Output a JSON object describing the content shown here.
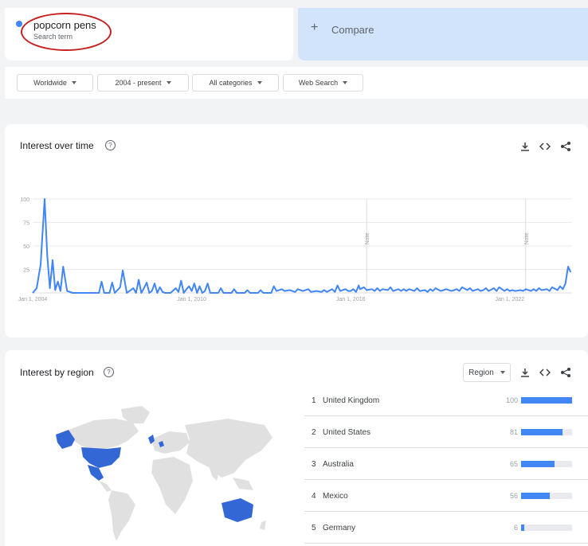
{
  "search": {
    "term": "popcorn pens",
    "subtitle": "Search term",
    "compare_label": "Compare",
    "compare_icon": "plus-icon"
  },
  "filters": [
    {
      "label": "Worldwide"
    },
    {
      "label": "2004 - present"
    },
    {
      "label": "All categories"
    },
    {
      "label": "Web Search"
    }
  ],
  "interest_over_time": {
    "title": "Interest over time",
    "help": "?",
    "tools": [
      "download-icon",
      "embed-icon",
      "share-icon"
    ]
  },
  "chart_data": {
    "type": "line",
    "ylim": [
      0,
      100
    ],
    "yticks": [
      "100",
      "75",
      "50",
      "25"
    ],
    "xticks": [
      "Jan 1, 2004",
      "Jan 1, 2010",
      "Jan 1, 2016",
      "Jan 1, 2022"
    ],
    "notes": [
      {
        "label": "Note",
        "year": 2016.6
      },
      {
        "label": "Note",
        "year": 2022.6
      }
    ],
    "series": [
      {
        "color": "#4285f4",
        "points": [
          [
            2004.0,
            0
          ],
          [
            2004.15,
            5
          ],
          [
            2004.3,
            30
          ],
          [
            2004.45,
            100
          ],
          [
            2004.55,
            40
          ],
          [
            2004.65,
            5
          ],
          [
            2004.75,
            35
          ],
          [
            2004.85,
            3
          ],
          [
            2004.95,
            12
          ],
          [
            2005.05,
            2
          ],
          [
            2005.15,
            28
          ],
          [
            2005.3,
            2
          ],
          [
            2005.5,
            0
          ],
          [
            2006.5,
            0
          ],
          [
            2006.6,
            12
          ],
          [
            2006.7,
            0
          ],
          [
            2006.9,
            0
          ],
          [
            2007.0,
            11
          ],
          [
            2007.1,
            0
          ],
          [
            2007.3,
            6
          ],
          [
            2007.4,
            24
          ],
          [
            2007.55,
            0
          ],
          [
            2007.8,
            5
          ],
          [
            2007.9,
            0
          ],
          [
            2008.0,
            14
          ],
          [
            2008.1,
            0
          ],
          [
            2008.2,
            5
          ],
          [
            2008.3,
            11
          ],
          [
            2008.4,
            0
          ],
          [
            2008.5,
            2
          ],
          [
            2008.6,
            10
          ],
          [
            2008.7,
            0
          ],
          [
            2008.8,
            6
          ],
          [
            2008.9,
            1
          ],
          [
            2009.0,
            0
          ],
          [
            2009.2,
            0
          ],
          [
            2009.4,
            5
          ],
          [
            2009.5,
            1
          ],
          [
            2009.6,
            13
          ],
          [
            2009.7,
            0
          ],
          [
            2009.8,
            4
          ],
          [
            2009.9,
            7
          ],
          [
            2010.0,
            2
          ],
          [
            2010.1,
            10
          ],
          [
            2010.2,
            0
          ],
          [
            2010.3,
            7
          ],
          [
            2010.4,
            0
          ],
          [
            2010.5,
            2
          ],
          [
            2010.6,
            10
          ],
          [
            2010.7,
            0
          ],
          [
            2011.0,
            0
          ],
          [
            2011.1,
            5
          ],
          [
            2011.2,
            0
          ],
          [
            2011.5,
            0
          ],
          [
            2011.6,
            4
          ],
          [
            2011.7,
            0
          ],
          [
            2012.0,
            0
          ],
          [
            2012.1,
            3
          ],
          [
            2012.2,
            0
          ],
          [
            2012.5,
            0
          ],
          [
            2012.6,
            3
          ],
          [
            2012.7,
            0
          ],
          [
            2013.0,
            0
          ],
          [
            2013.1,
            7
          ],
          [
            2013.2,
            2
          ],
          [
            2013.4,
            4
          ],
          [
            2013.5,
            2
          ],
          [
            2013.7,
            3
          ],
          [
            2013.9,
            1
          ],
          [
            2014.0,
            4
          ],
          [
            2014.2,
            2
          ],
          [
            2014.4,
            4
          ],
          [
            2014.5,
            1
          ],
          [
            2014.7,
            2
          ],
          [
            2014.9,
            1
          ],
          [
            2015.0,
            3
          ],
          [
            2015.1,
            1
          ],
          [
            2015.3,
            4
          ],
          [
            2015.4,
            1
          ],
          [
            2015.5,
            8
          ],
          [
            2015.6,
            2
          ],
          [
            2015.8,
            4
          ],
          [
            2015.9,
            2
          ],
          [
            2016.0,
            2
          ],
          [
            2016.1,
            4
          ],
          [
            2016.2,
            1
          ],
          [
            2016.3,
            8
          ],
          [
            2016.35,
            4
          ],
          [
            2016.5,
            6
          ],
          [
            2016.6,
            3
          ],
          [
            2016.8,
            4
          ],
          [
            2016.9,
            2
          ],
          [
            2017.0,
            5
          ],
          [
            2017.1,
            2
          ],
          [
            2017.2,
            4
          ],
          [
            2017.4,
            3
          ],
          [
            2017.5,
            6
          ],
          [
            2017.6,
            2
          ],
          [
            2017.8,
            4
          ],
          [
            2017.9,
            2
          ],
          [
            2018.0,
            4
          ],
          [
            2018.1,
            2
          ],
          [
            2018.2,
            4
          ],
          [
            2018.4,
            2
          ],
          [
            2018.5,
            5
          ],
          [
            2018.6,
            2
          ],
          [
            2018.8,
            3
          ],
          [
            2018.9,
            1
          ],
          [
            2019.0,
            4
          ],
          [
            2019.1,
            2
          ],
          [
            2019.2,
            5
          ],
          [
            2019.4,
            2
          ],
          [
            2019.5,
            3
          ],
          [
            2019.6,
            4
          ],
          [
            2019.8,
            2
          ],
          [
            2019.9,
            3
          ],
          [
            2020.0,
            4
          ],
          [
            2020.1,
            2
          ],
          [
            2020.2,
            6
          ],
          [
            2020.4,
            3
          ],
          [
            2020.5,
            5
          ],
          [
            2020.6,
            2
          ],
          [
            2020.8,
            4
          ],
          [
            2020.9,
            2
          ],
          [
            2021.0,
            3
          ],
          [
            2021.1,
            5
          ],
          [
            2021.2,
            2
          ],
          [
            2021.4,
            5
          ],
          [
            2021.5,
            2
          ],
          [
            2021.6,
            6
          ],
          [
            2021.8,
            2
          ],
          [
            2021.9,
            4
          ],
          [
            2022.0,
            2
          ],
          [
            2022.1,
            3
          ],
          [
            2022.2,
            2
          ],
          [
            2022.4,
            3
          ],
          [
            2022.5,
            2
          ],
          [
            2022.6,
            4
          ],
          [
            2022.8,
            2
          ],
          [
            2022.9,
            4
          ],
          [
            2023.0,
            2
          ],
          [
            2023.1,
            5
          ],
          [
            2023.2,
            3
          ],
          [
            2023.4,
            4
          ],
          [
            2023.5,
            2
          ],
          [
            2023.6,
            6
          ],
          [
            2023.8,
            3
          ],
          [
            2023.9,
            7
          ],
          [
            2024.0,
            4
          ],
          [
            2024.1,
            10
          ],
          [
            2024.2,
            28
          ],
          [
            2024.3,
            22
          ]
        ]
      }
    ]
  },
  "interest_by_region": {
    "title": "Interest by region",
    "help": "?",
    "select_label": "Region",
    "tools": [
      "download-icon",
      "embed-icon",
      "share-icon"
    ],
    "map_highlight": [
      "United Kingdom",
      "United States",
      "Australia",
      "Mexico",
      "Germany"
    ],
    "rows": [
      {
        "rank": "1",
        "name": "United Kingdom",
        "value": "100",
        "fraction": 1.0
      },
      {
        "rank": "2",
        "name": "United States",
        "value": "81",
        "fraction": 0.81
      },
      {
        "rank": "3",
        "name": "Australia",
        "value": "65",
        "fraction": 0.65
      },
      {
        "rank": "4",
        "name": "Mexico",
        "value": "56",
        "fraction": 0.56
      },
      {
        "rank": "5",
        "name": "Germany",
        "value": "6",
        "fraction": 0.06
      }
    ]
  },
  "colors": {
    "series": "#4285f4",
    "compare_bg": "#d2e3fc",
    "highlight": "#c5221f",
    "map_land": "#e0e0e0",
    "map_active": "#3367d6"
  }
}
